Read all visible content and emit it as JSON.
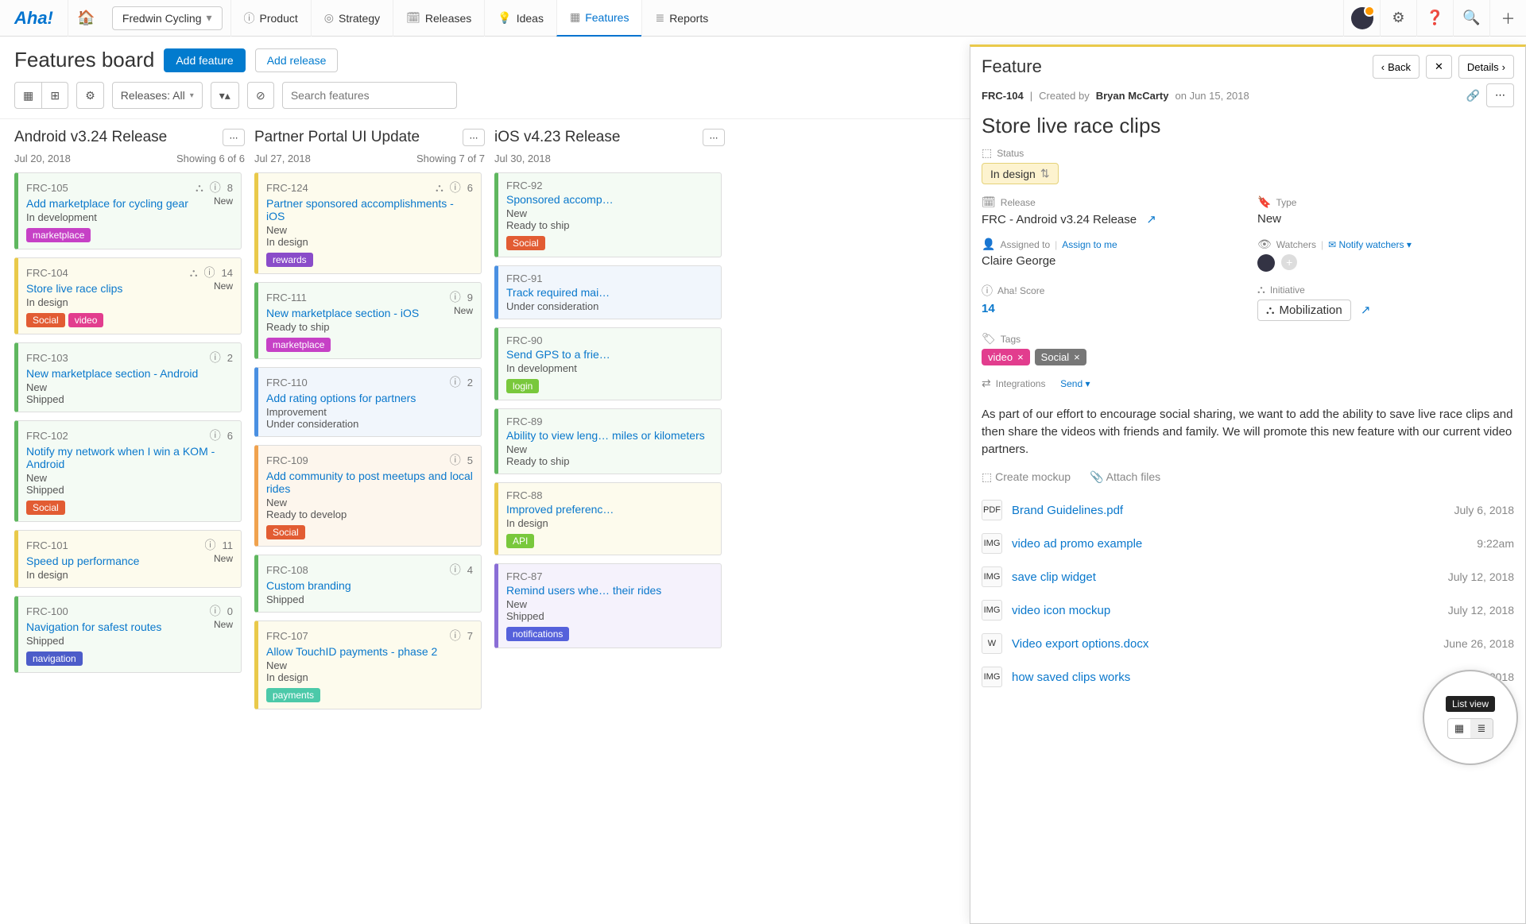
{
  "app": {
    "logo": "Aha!"
  },
  "nav": {
    "workspace": "Fredwin Cycling",
    "items": [
      {
        "label": "Product",
        "icon": "ⓘ"
      },
      {
        "label": "Strategy",
        "icon": "◎"
      },
      {
        "label": "Releases",
        "icon": "🗓"
      },
      {
        "label": "Ideas",
        "icon": "💡"
      },
      {
        "label": "Features",
        "icon": "▦",
        "active": true
      },
      {
        "label": "Reports",
        "icon": "≣"
      }
    ]
  },
  "page": {
    "title": "Features board",
    "add_feature": "Add feature",
    "add_release": "Add release",
    "filter_label": "Releases: All",
    "search_placeholder": "Search features"
  },
  "columns": [
    {
      "title": "Android v3.24 Release",
      "date": "Jul 20, 2018",
      "showing": "Showing 6 of 6",
      "cards": [
        {
          "id": "FRC-105",
          "name": "Add marketplace for cycling gear",
          "count": 8,
          "new": true,
          "tone": "green",
          "lines": [
            "In development"
          ],
          "tags": [
            {
              "t": "marketplace",
              "c": "marketplace"
            }
          ],
          "tree": true
        },
        {
          "id": "FRC-104",
          "name": "Store live race clips",
          "count": 14,
          "new": true,
          "tone": "yellow",
          "lines": [
            "In design"
          ],
          "tags": [
            {
              "t": "Social",
              "c": "social"
            },
            {
              "t": "video",
              "c": "video"
            }
          ],
          "tree": true
        },
        {
          "id": "FRC-103",
          "name": "New marketplace section - Android",
          "count": 2,
          "tone": "green",
          "lines": [
            "New",
            "Shipped"
          ]
        },
        {
          "id": "FRC-102",
          "name": "Notify my network when I win a KOM - Android",
          "count": 6,
          "tone": "green",
          "lines": [
            "New",
            "Shipped"
          ],
          "tags": [
            {
              "t": "Social",
              "c": "social"
            }
          ]
        },
        {
          "id": "FRC-101",
          "name": "Speed up performance",
          "count": 11,
          "new": true,
          "tone": "yellow",
          "lines": [
            "In design"
          ]
        },
        {
          "id": "FRC-100",
          "name": "Navigation for safest routes",
          "count": 0,
          "new": true,
          "tone": "green",
          "lines": [
            "Shipped"
          ],
          "tags": [
            {
              "t": "navigation",
              "c": "navigation"
            }
          ]
        }
      ]
    },
    {
      "title": "Partner Portal UI Update",
      "date": "Jul 27, 2018",
      "showing": "Showing 7 of 7",
      "cards": [
        {
          "id": "FRC-124",
          "name": "Partner sponsored accomplishments - iOS",
          "count": 6,
          "tone": "yellow",
          "lines": [
            "New",
            "In design"
          ],
          "tags": [
            {
              "t": "rewards",
              "c": "rewards"
            }
          ],
          "tree": true
        },
        {
          "id": "FRC-111",
          "name": "New marketplace section - iOS",
          "count": 9,
          "new": true,
          "tone": "green",
          "lines": [
            "Ready to ship"
          ],
          "tags": [
            {
              "t": "marketplace",
              "c": "marketplace"
            }
          ]
        },
        {
          "id": "FRC-110",
          "name": "Add rating options for partners",
          "count": 2,
          "tone": "blue",
          "lines": [
            "Improvement",
            "Under consideration"
          ]
        },
        {
          "id": "FRC-109",
          "name": "Add community to post meetups and local rides",
          "count": 5,
          "tone": "orange",
          "lines": [
            "New",
            "Ready to develop"
          ],
          "tags": [
            {
              "t": "Social",
              "c": "social"
            }
          ]
        },
        {
          "id": "FRC-108",
          "name": "Custom branding",
          "count": 4,
          "tone": "green",
          "lines": [
            "Shipped"
          ]
        },
        {
          "id": "FRC-107",
          "name": "Allow TouchID payments - phase 2",
          "count": 7,
          "tone": "yellow",
          "lines": [
            "New",
            "In design"
          ],
          "tags": [
            {
              "t": "payments",
              "c": "payments"
            }
          ]
        }
      ]
    },
    {
      "title": "iOS v4.23 Release",
      "date": "Jul 30, 2018",
      "showing": "",
      "cards": [
        {
          "id": "FRC-92",
          "name": "Sponsored accomp…",
          "tone": "green",
          "lines": [
            "New",
            "Ready to ship"
          ],
          "tags": [
            {
              "t": "Social",
              "c": "social"
            }
          ]
        },
        {
          "id": "FRC-91",
          "name": "Track required mai…",
          "tone": "blue",
          "lines": [
            "Under consideration"
          ]
        },
        {
          "id": "FRC-90",
          "name": "Send GPS to a frie…",
          "tone": "green",
          "lines": [
            "In development"
          ],
          "tags": [
            {
              "t": "login",
              "c": "login"
            }
          ]
        },
        {
          "id": "FRC-89",
          "name": "Ability to view leng… miles or kilometers",
          "tone": "green",
          "lines": [
            "New",
            "Ready to ship"
          ]
        },
        {
          "id": "FRC-88",
          "name": "Improved preferenc…",
          "tone": "yellow",
          "lines": [
            "In design"
          ],
          "tags": [
            {
              "t": "API",
              "c": "api"
            }
          ]
        },
        {
          "id": "FRC-87",
          "name": "Remind users whe… their rides",
          "tone": "purple",
          "lines": [
            "New",
            "Shipped"
          ],
          "tags": [
            {
              "t": "notifications",
              "c": "notifications"
            }
          ]
        }
      ]
    }
  ],
  "detail": {
    "heading": "Feature",
    "back": "Back",
    "details": "Details",
    "ref": "FRC-104",
    "created_prefix": "Created by",
    "created_by": "Bryan McCarty",
    "created_on": "on Jun 15, 2018",
    "title": "Store live race clips",
    "status_label": "Status",
    "status": "In design",
    "release_label": "Release",
    "release": "FRC - Android v3.24 Release",
    "type_label": "Type",
    "type": "New",
    "assigned_label": "Assigned to",
    "assign_link": "Assign to me",
    "assignee": "Claire George",
    "watchers_label": "Watchers",
    "notify": "Notify watchers",
    "score_label": "Aha! Score",
    "score": "14",
    "initiative_label": "Initiative",
    "initiative": "Mobilization",
    "tags_label": "Tags",
    "tags": [
      {
        "t": "video",
        "c": "video"
      },
      {
        "t": "Social",
        "c": "social"
      }
    ],
    "integrations_label": "Integrations",
    "send": "Send",
    "description": "As part of our effort to encourage social sharing, we want to add the ability to save live race clips and then share the videos with friends and family. We will promote this new feature with our current video partners.",
    "mockup": "Create mockup",
    "attach": "Attach files",
    "files": [
      {
        "name": "Brand Guidelines.pdf",
        "date": "July 6, 2018",
        "ico": "PDF"
      },
      {
        "name": "video ad promo example",
        "date": "9:22am",
        "ico": "IMG"
      },
      {
        "name": "save clip widget",
        "date": "July 12, 2018",
        "ico": "IMG"
      },
      {
        "name": "video icon mockup",
        "date": "July 12, 2018",
        "ico": "IMG"
      },
      {
        "name": "Video export options.docx",
        "date": "June 26, 2018",
        "ico": "W"
      },
      {
        "name": "how saved clips works",
        "date": "July 3, 2018",
        "ico": "IMG"
      }
    ]
  },
  "zoom": {
    "tip": "List view"
  }
}
